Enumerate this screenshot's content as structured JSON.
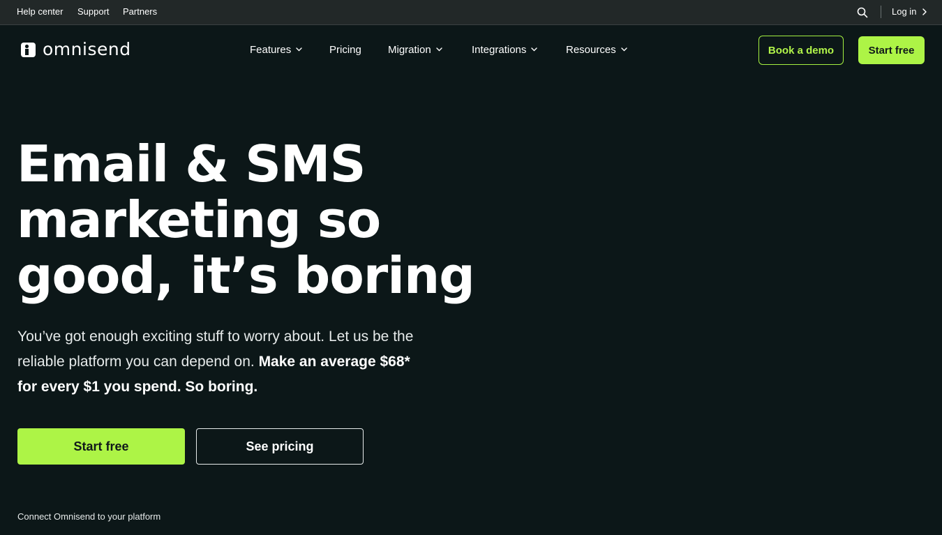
{
  "topbar": {
    "links": [
      "Help center",
      "Support",
      "Partners"
    ],
    "login": "Log in"
  },
  "brand": {
    "name": "omnisend",
    "accent": "#adf446"
  },
  "nav": {
    "features": "Features",
    "pricing": "Pricing",
    "migration": "Migration",
    "integrations": "Integrations",
    "resources": "Resources"
  },
  "cta": {
    "book_demo": "Book a demo",
    "start_free": "Start free"
  },
  "hero": {
    "title_lines": [
      "Email & SMS",
      "marketing so",
      "good, it’s boring"
    ],
    "subtitle_plain": "You’ve got enough exciting stuff to worry about. Let us be the reliable platform you can depend on. ",
    "subtitle_bold": "Make an average $68* for every $1 you spend. So boring.",
    "start_free": "Start free",
    "see_pricing": "See pricing",
    "connect_text": "Connect Omnisend to your platform"
  }
}
